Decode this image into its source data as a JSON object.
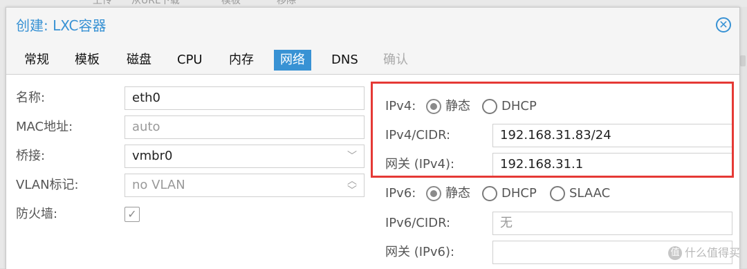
{
  "background": {
    "tabs": [
      "上传",
      "从URL下载",
      "模板",
      "移除"
    ]
  },
  "dialog": {
    "title": "创建: LXC容器",
    "close_icon": "close-circle-icon"
  },
  "tabs": [
    {
      "label": "常规"
    },
    {
      "label": "模板"
    },
    {
      "label": "磁盘"
    },
    {
      "label": "CPU"
    },
    {
      "label": "内存"
    },
    {
      "label": "网络"
    },
    {
      "label": "DNS"
    },
    {
      "label": "确认"
    }
  ],
  "left": {
    "name_label": "名称:",
    "name_value": "eth0",
    "mac_label": "MAC地址:",
    "mac_placeholder": "auto",
    "bridge_label": "桥接:",
    "bridge_value": "vmbr0",
    "vlan_label": "VLAN标记:",
    "vlan_placeholder": "no VLAN",
    "firewall_label": "防火墙:"
  },
  "right": {
    "ipv4_label": "IPv4:",
    "ipv4_static": "静态",
    "ipv4_dhcp": "DHCP",
    "ipv4_cidr_label": "IPv4/CIDR:",
    "ipv4_cidr_value": "192.168.31.83/24",
    "gw4_label": "网关 (IPv4):",
    "gw4_value": "192.168.31.1",
    "ipv6_label": "IPv6:",
    "ipv6_static": "静态",
    "ipv6_dhcp": "DHCP",
    "ipv6_slaac": "SLAAC",
    "ipv6_cidr_label": "IPv6/CIDR:",
    "ipv6_cidr_placeholder": "无",
    "gw6_label": "网关 (IPv6):",
    "gw6_value": ""
  },
  "colors": {
    "accent": "#3892d4",
    "highlight": "#e53935"
  },
  "watermark": {
    "badge": "值",
    "text": "什么值得买"
  }
}
